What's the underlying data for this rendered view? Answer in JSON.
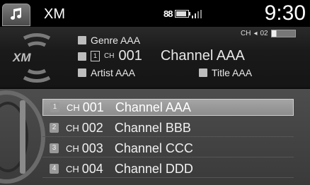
{
  "header": {
    "title": "XM",
    "bt_icon": "88",
    "clock": "9:30"
  },
  "now_playing": {
    "genre": "Genre AAA",
    "ch_label": "CH",
    "preset_num": "1",
    "channel_number": "001",
    "channel_name": "Channel AAA",
    "artist": "Artist AAA",
    "song_title": "Title AAA",
    "signal_label": "CH",
    "signal_channel": "02"
  },
  "logo_text": "XM",
  "channel_list": [
    {
      "preset": "1",
      "ch_label": "CH",
      "number": "001",
      "name": "Channel AAA",
      "selected": true
    },
    {
      "preset": "2",
      "ch_label": "CH",
      "number": "002",
      "name": "Channel BBB",
      "selected": false
    },
    {
      "preset": "3",
      "ch_label": "CH",
      "number": "003",
      "name": "Channel CCC",
      "selected": false
    },
    {
      "preset": "4",
      "ch_label": "CH",
      "number": "004",
      "name": "Channel DDD",
      "selected": false
    }
  ],
  "colors": {
    "background": "#0d0d0d",
    "list_background": "#444444",
    "selected_row": "#9a9a9a",
    "text": "#ffffff"
  },
  "icons": [
    "music-note-icon",
    "xm-logo-icon",
    "genre-icon",
    "preset-icon",
    "artist-icon",
    "title-icon",
    "bluetooth-icon",
    "battery-icon",
    "signal-icon"
  ]
}
